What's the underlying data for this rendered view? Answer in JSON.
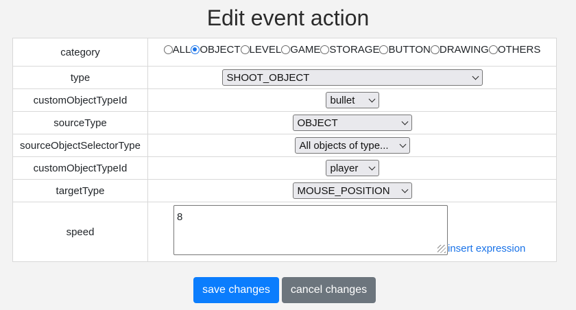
{
  "page": {
    "title": "Edit event action"
  },
  "category": {
    "label": "category",
    "options": [
      "ALL",
      "OBJECT",
      "LEVEL",
      "GAME",
      "STORAGE",
      "BUTTON",
      "DRAWING",
      "OTHERS"
    ],
    "selected": "OBJECT"
  },
  "type": {
    "label": "type",
    "value": "SHOOT_OBJECT"
  },
  "customObjectTypeId1": {
    "label": "customObjectTypeId",
    "value": "bullet"
  },
  "sourceType": {
    "label": "sourceType",
    "value": "OBJECT"
  },
  "sourceObjectSelectorType": {
    "label": "sourceObjectSelectorType",
    "value": "All objects of type..."
  },
  "customObjectTypeId2": {
    "label": "customObjectTypeId",
    "value": "player"
  },
  "targetType": {
    "label": "targetType",
    "value": "MOUSE_POSITION"
  },
  "speed": {
    "label": "speed",
    "value": "8",
    "insert_link": "insert expression"
  },
  "buttons": {
    "save": "save changes",
    "cancel": "cancel changes"
  },
  "colors": {
    "primary": "#0b7dfd",
    "secondary": "#6c757d",
    "link": "#1a73e8"
  }
}
